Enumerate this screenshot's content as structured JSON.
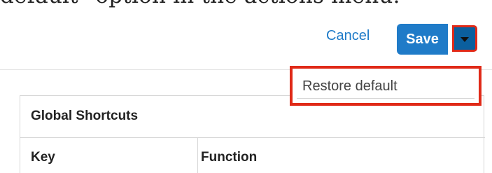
{
  "caption": {
    "text": "default\" option in the actions menu."
  },
  "header": {
    "cancel_label": "Cancel",
    "save_label": "Save",
    "accent_color": "#1f7bc8",
    "toggle_color": "#0b5f9e",
    "highlight_color": "#e02a18"
  },
  "actions_menu": {
    "items": [
      {
        "label": "Restore default"
      }
    ]
  },
  "shortcuts_table": {
    "title": "Global Shortcuts",
    "columns": [
      "Key",
      "Function"
    ]
  }
}
